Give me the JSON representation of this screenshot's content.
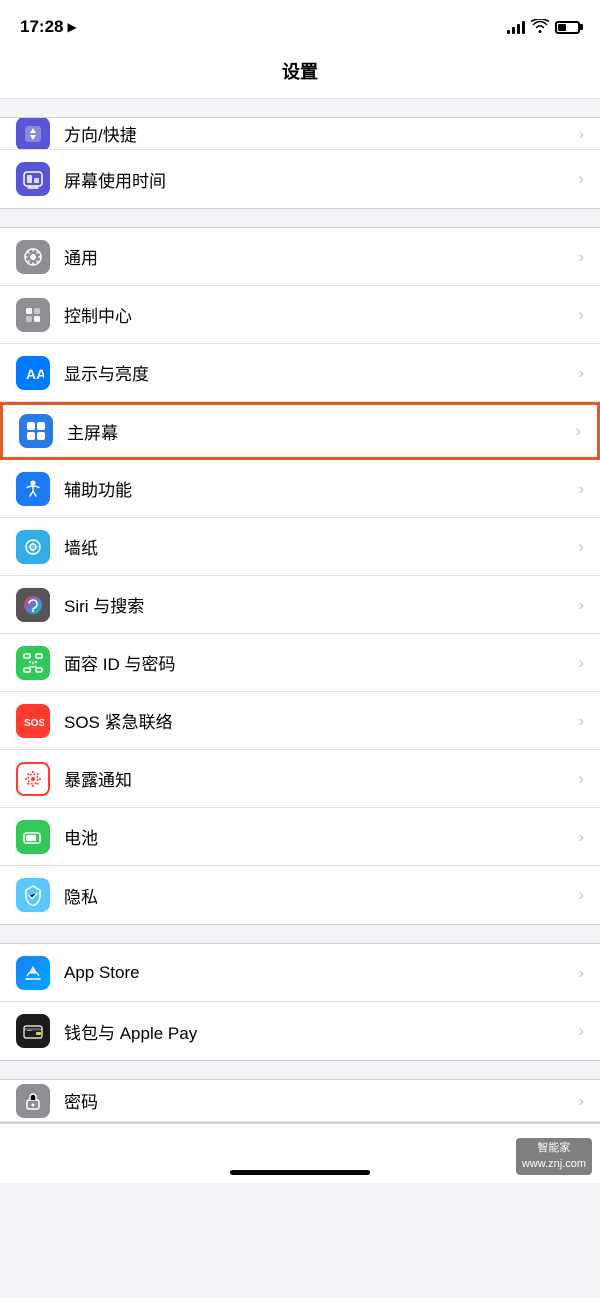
{
  "statusBar": {
    "time": "17:28",
    "locationIcon": "▶",
    "batteryLevel": 40
  },
  "pageTitle": "设置",
  "sections": [
    {
      "id": "section-top-partial",
      "rows": [
        {
          "id": "fangxiang",
          "icon": "screen-time",
          "iconBg": "icon-screen-time",
          "label": "方向/快捷",
          "partial": true
        },
        {
          "id": "screen-time",
          "icon": "hourglass",
          "iconBg": "icon-screen-time",
          "label": "屏幕使用时间",
          "partial": false
        }
      ]
    },
    {
      "id": "section-general",
      "rows": [
        {
          "id": "general",
          "iconBg": "icon-gray",
          "label": "通用"
        },
        {
          "id": "control-center",
          "iconBg": "icon-gray",
          "label": "控制中心"
        },
        {
          "id": "display",
          "iconBg": "icon-blue",
          "label": "显示与亮度"
        },
        {
          "id": "home-screen",
          "iconBg": "icon-blue",
          "label": "主屏幕",
          "highlighted": true
        },
        {
          "id": "accessibility",
          "iconBg": "icon-blue",
          "label": "辅助功能"
        },
        {
          "id": "wallpaper",
          "iconBg": "icon-teal",
          "label": "墙纸"
        },
        {
          "id": "siri",
          "iconBg": "icon-dark-bg",
          "label": "Siri 与搜索"
        },
        {
          "id": "faceid",
          "iconBg": "icon-green",
          "label": "面容 ID 与密码"
        },
        {
          "id": "sos",
          "iconBg": "icon-red",
          "label": "SOS 紧急联络"
        },
        {
          "id": "exposure",
          "iconBg": "icon-red-outline",
          "label": "暴露通知"
        },
        {
          "id": "battery",
          "iconBg": "icon-green",
          "label": "电池"
        },
        {
          "id": "privacy",
          "iconBg": "icon-blue-hand",
          "label": "隐私"
        }
      ]
    },
    {
      "id": "section-store",
      "rows": [
        {
          "id": "app-store",
          "iconBg": "icon-blue",
          "label": "App Store"
        },
        {
          "id": "wallet",
          "iconBg": "icon-dark",
          "label": "钱包与 Apple Pay"
        }
      ]
    },
    {
      "id": "section-password",
      "rows": [
        {
          "id": "password",
          "iconBg": "icon-gray",
          "label": "密码",
          "partial": true
        }
      ]
    }
  ],
  "watermark": {
    "line1": "智能家",
    "line2": "www.znj.com"
  }
}
